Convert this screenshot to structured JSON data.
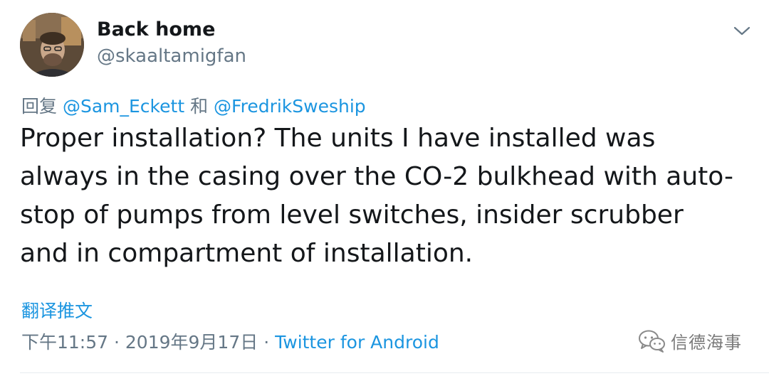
{
  "author": {
    "name": "Back home",
    "handle": "@skaaltamigfan"
  },
  "reply": {
    "prefix": "回复",
    "mention_1": "@Sam_Eckett",
    "conjunction": "和",
    "mention_2": "@FredrikSweship"
  },
  "tweet": {
    "text": "Proper installation? The units I have installed was always in the casing over the CO-2 bulkhead with auto-stop of pumps from level switches, insider scrubber and in compartment of installation."
  },
  "translate_label": "翻译推文",
  "meta": {
    "time": "下午11:57",
    "separator": "·",
    "date": "2019年9月17日",
    "source": "Twitter for Android"
  },
  "watermark": {
    "text": "信德海事",
    "icon": "wechat-icon"
  },
  "icons": {
    "caret": "chevron-down-icon",
    "avatar": "avatar-photo"
  },
  "colors": {
    "text": "#14171a",
    "secondary": "#657786",
    "link": "#1b95e0",
    "watermark": "#7a7a7a"
  }
}
